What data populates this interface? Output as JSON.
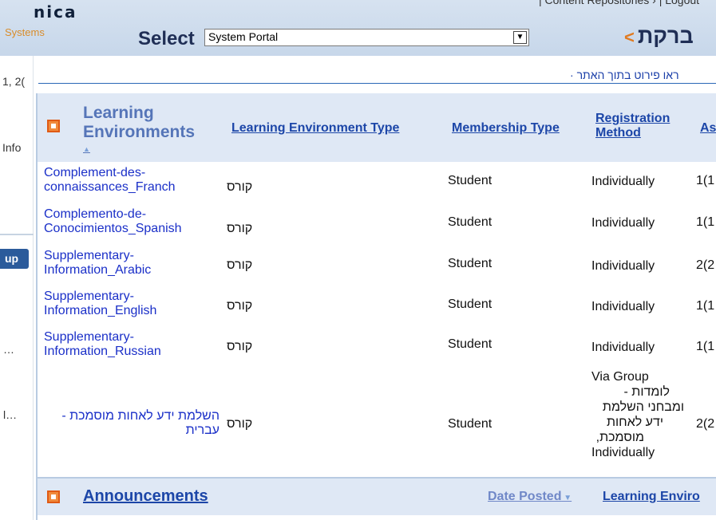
{
  "header": {
    "logo_main": "nica",
    "logo_sub": "Systems",
    "select_label": "Select",
    "portal_value": "System Portal",
    "top_links": "| Content Repositories › | Logout",
    "brand_he": "ברקת",
    "brand_chevron": "<"
  },
  "left": {
    "date": "1, 2(",
    "info": "Info",
    "button": "up",
    "dots1": "…",
    "dots2": "l…"
  },
  "breadcrumb": "· ראו פירוט בתוך האתר",
  "table": {
    "headers": {
      "learning_env": "Learning Environments",
      "le_type": "Learning Environment Type",
      "membership": "Membership Type",
      "registration_1": "Registration",
      "registration_2": "Method",
      "as": "As"
    },
    "rows": [
      {
        "name1": "Complement-des-",
        "name2": "connaissances_Franch",
        "type": "קורס",
        "membership": "Student",
        "registration": "Individually",
        "as": "1(1"
      },
      {
        "name1": "Complemento-de-",
        "name2": "Conocimientos_Spanish",
        "type": "קורס",
        "membership": "Student",
        "registration": "Individually",
        "as": "1(1"
      },
      {
        "name1": "Supplementary-",
        "name2": "Information_Arabic",
        "type": "קורס",
        "membership": "Student",
        "registration": "Individually",
        "as": "2(2"
      },
      {
        "name1": "Supplementary-",
        "name2": "Information_English",
        "type": "קורס",
        "membership": "Student",
        "registration": "Individually",
        "as": "1(1"
      },
      {
        "name1": "Supplementary-",
        "name2": "Information_Russian",
        "type": "קורס",
        "membership": "Student",
        "registration": "Individually",
        "as": "1(1"
      },
      {
        "name1": "השלמת ידע לאחות מוסמכת -",
        "name2": "עברית",
        "type": "קורס",
        "membership": "Student",
        "registration_lines": [
          "Via Group",
          "לומדות -",
          "ומבחני השלמת",
          "ידע לאחות",
          "מוסמכת,",
          "Individually"
        ],
        "as": "2(2"
      }
    ]
  },
  "announcements": {
    "title": "Announcements",
    "date_posted": "Date Posted",
    "learning_env": "Learning Enviro"
  },
  "colors": {
    "link_blue": "#1c46a8",
    "header_bg": "#c7d7ea",
    "orange": "#f08a3c"
  }
}
